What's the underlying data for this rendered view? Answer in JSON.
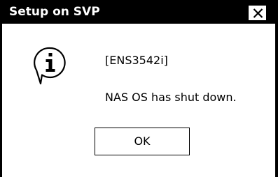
{
  "window": {
    "title": "Setup on SVP",
    "close_icon": "close-x-icon"
  },
  "message": {
    "icon": "information-speech-bubble-icon",
    "code": "[ENS3542i]",
    "text": "NAS OS has shut down."
  },
  "buttons": {
    "ok_label": "OK"
  },
  "colors": {
    "titlebar_bg": "#000000",
    "titlebar_text": "#ffffff",
    "dialog_bg": "#ffffff",
    "text": "#000000"
  }
}
